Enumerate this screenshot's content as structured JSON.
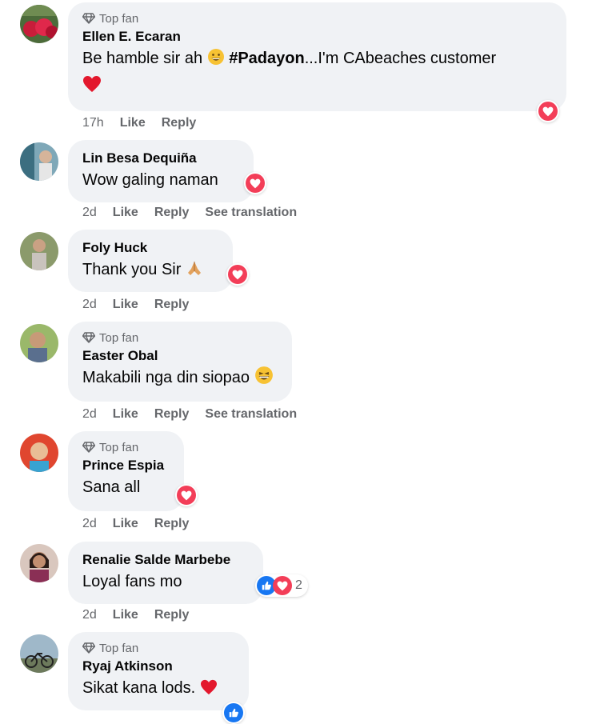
{
  "comments": [
    {
      "top_fan_label": "Top fan",
      "author": "Ellen E. Ecaran",
      "text_before": "Be hamble sir ah ",
      "hashtag": "#Padayon",
      "text_after": "...I'm CAbeaches customer",
      "time": "17h",
      "like": "Like",
      "reply": "Reply",
      "reaction": "love"
    },
    {
      "author": "Lin Besa Dequiña",
      "text": "Wow galing naman",
      "time": "2d",
      "like": "Like",
      "reply": "Reply",
      "translate": "See translation",
      "reaction": "love"
    },
    {
      "author": "Foly Huck",
      "text": "Thank you Sir",
      "time": "2d",
      "like": "Like",
      "reply": "Reply",
      "reaction": "love"
    },
    {
      "top_fan_label": "Top fan",
      "author": "Easter Obal",
      "text": "Makabili nga din siopao",
      "time": "2d",
      "like": "Like",
      "reply": "Reply",
      "translate": "See translation"
    },
    {
      "top_fan_label": "Top fan",
      "author": "Prince Espia",
      "text": "Sana all",
      "time": "2d",
      "like": "Like",
      "reply": "Reply",
      "reaction": "love"
    },
    {
      "author": "Renalie Salde Marbebe",
      "text": "Loyal fans mo",
      "time": "2d",
      "like": "Like",
      "reply": "Reply",
      "reaction": "like+love",
      "reaction_count": "2"
    },
    {
      "top_fan_label": "Top fan",
      "author": "Ryaj Atkinson",
      "text": "Sikat kana lods.",
      "reaction": "like"
    }
  ],
  "colors": {
    "bubble": "#f0f2f5",
    "secondary_text": "#65676b",
    "love": "#f33e58",
    "like": "#1877f2"
  },
  "icons": [
    "top-fan-diamond-icon",
    "grinning-emoji-icon",
    "red-heart-icon",
    "folded-hands-emoji-icon",
    "laughing-emoji-icon",
    "love-reaction-icon",
    "like-reaction-icon"
  ]
}
